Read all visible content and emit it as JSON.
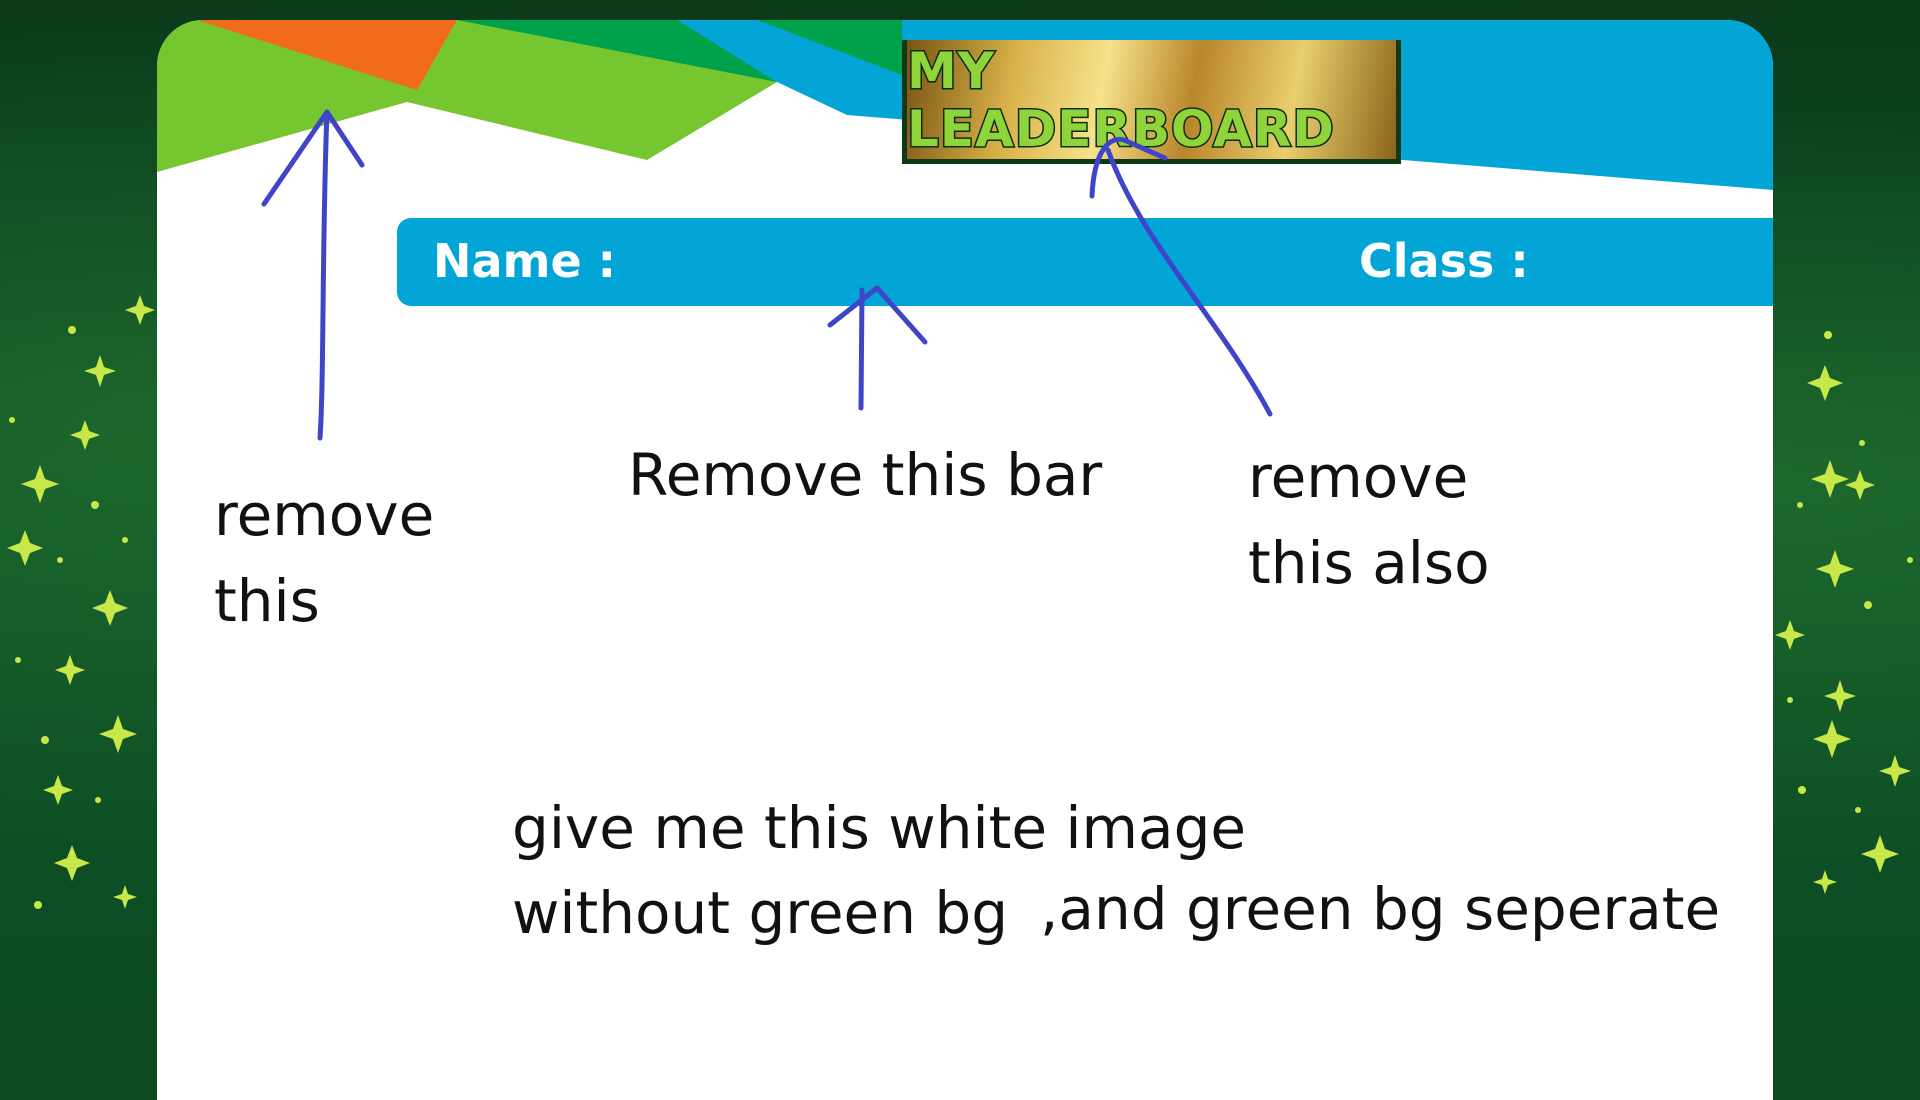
{
  "leaderboard": {
    "title": "MY LEADERBOARD",
    "name_label": "Name :",
    "class_label": "Class :"
  },
  "annotations": {
    "remove_this_line1": "remove",
    "remove_this_line2": "this",
    "remove_bar": "Remove this bar",
    "remove_also_line1": "remove",
    "remove_also_line2": "this also",
    "request_line1": "give me this white image",
    "request_line2a": "without green bg",
    "request_line2b": ",and green bg seperate"
  },
  "colors": {
    "background_green": "#0d4a22",
    "card_white": "#ffffff",
    "bar_blue": "#02a5d6",
    "banner_green": "#76c62f",
    "banner_dark_green": "#00a14b",
    "banner_orange": "#f26b1d",
    "title_gold": "#d9b24a",
    "title_text_green": "#8fd43a",
    "sparkle_yellow": "#c8e84a",
    "annotation_ink": "#3f45c8"
  }
}
